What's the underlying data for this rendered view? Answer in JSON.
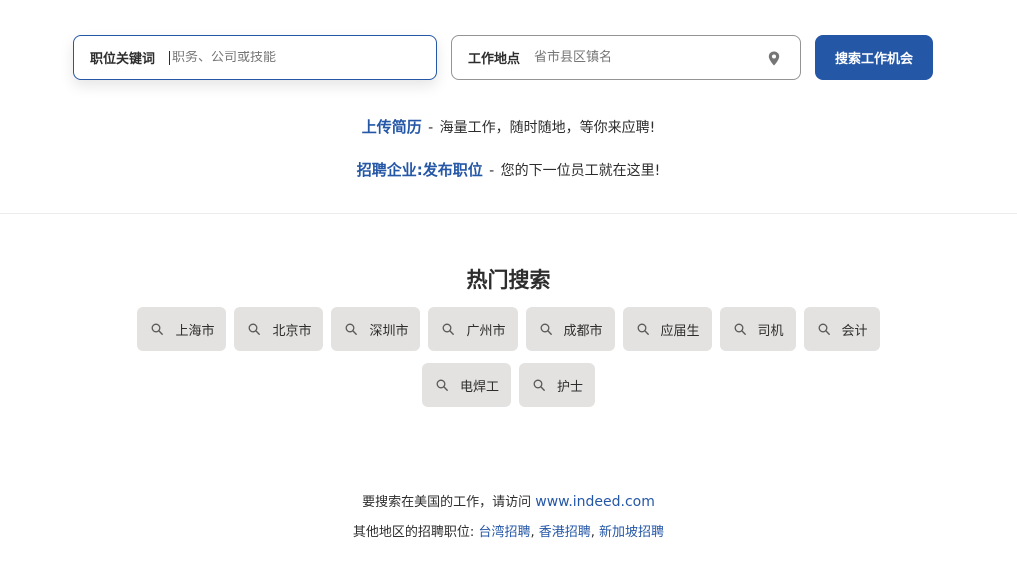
{
  "search": {
    "what_label": "职位关键词",
    "what_placeholder": "职务、公司或技能",
    "where_label": "工作地点",
    "where_placeholder": "省市县区镇名",
    "button_label": "搜索工作机会",
    "pin_icon": "map-pin-icon"
  },
  "promo": {
    "upload_link": "上传简历",
    "upload_sep": " - ",
    "upload_text": "海量工作，随时随地，等你来应聘!",
    "employer_label": "招聘企业:",
    "post_job_link": "发布职位",
    "post_sep": " - ",
    "post_text": "您的下一位员工就在这里!"
  },
  "popular": {
    "title": "热门搜索",
    "icon": "search-icon",
    "items": [
      "上海市",
      "北京市",
      "深圳市",
      "广州市",
      "成都市",
      "应届生",
      "司机",
      "会计",
      "电焊工",
      "护士"
    ]
  },
  "footer": {
    "us_text": "要搜索在美国的工作，请访问",
    "us_link": "www.indeed.com",
    "other_text": "其他地区的招聘职位:",
    "other_links": [
      "台湾招聘",
      "香港招聘",
      "新加坡招聘"
    ],
    "link_sep": ","
  },
  "colors": {
    "accent": "#2557a7",
    "chip_bg": "#e4e2e0",
    "text": "#2d2d2d"
  }
}
